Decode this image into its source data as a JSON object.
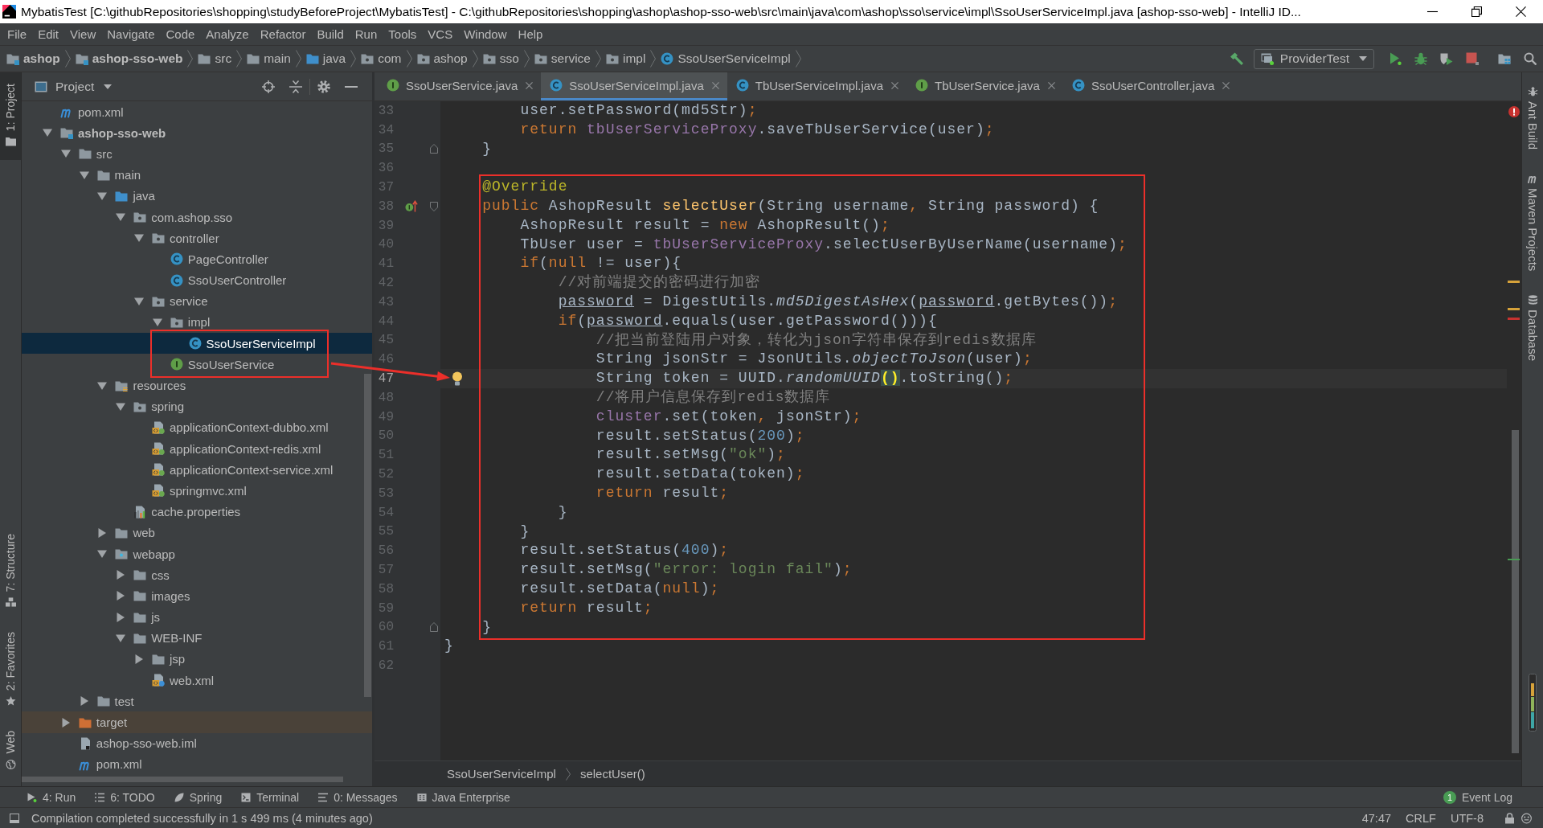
{
  "window": {
    "title": "MybatisTest [C:\\githubRepositories\\shopping\\studyBeforeProject\\MybatisTest] - C:\\githubRepositories\\shopping\\ashop\\ashop-sso-web\\src\\main\\java\\com\\ashop\\sso\\service\\impl\\SsoUserServiceImpl.java [ashop-sso-web] - IntelliJ ID..."
  },
  "menu": [
    "File",
    "Edit",
    "View",
    "Navigate",
    "Code",
    "Analyze",
    "Refactor",
    "Build",
    "Run",
    "Tools",
    "VCS",
    "Window",
    "Help"
  ],
  "navigation_bar": {
    "crumbs": [
      {
        "label": "ashop",
        "kind": "module"
      },
      {
        "label": "ashop-sso-web",
        "kind": "module"
      },
      {
        "label": "src",
        "kind": "folder"
      },
      {
        "label": "main",
        "kind": "folder"
      },
      {
        "label": "java",
        "kind": "source-root"
      },
      {
        "label": "com",
        "kind": "package"
      },
      {
        "label": "ashop",
        "kind": "package"
      },
      {
        "label": "sso",
        "kind": "package"
      },
      {
        "label": "service",
        "kind": "package"
      },
      {
        "label": "impl",
        "kind": "package"
      },
      {
        "label": "SsoUserServiceImpl",
        "kind": "class"
      }
    ],
    "run_configuration": "ProviderTest"
  },
  "left_strip": {
    "top": [
      {
        "label": "1: Project",
        "kind": "project",
        "selected": true
      }
    ],
    "bottom": [
      {
        "label": "7: Structure",
        "kind": "structure",
        "selected": false
      },
      {
        "label": "2: Favorites",
        "kind": "favorites",
        "selected": false
      },
      {
        "label": "Web",
        "kind": "web",
        "selected": false
      }
    ]
  },
  "right_strip": [
    {
      "label": "Ant Build",
      "kind": "ant"
    },
    {
      "label": "Maven Projects",
      "kind": "maven"
    },
    {
      "label": "Database",
      "kind": "database"
    }
  ],
  "project_panel": {
    "title": "Project",
    "tree": [
      {
        "label": "pom.xml",
        "kind": "maven",
        "selected": false
      },
      {
        "label": "ashop-sso-web",
        "kind": "module",
        "expanded": true,
        "selected": false,
        "children": [
          {
            "label": "src",
            "kind": "folder",
            "expanded": true,
            "selected": false,
            "children": [
              {
                "label": "main",
                "kind": "folder",
                "expanded": true,
                "selected": false,
                "children": [
                  {
                    "label": "java",
                    "kind": "source-root",
                    "expanded": true,
                    "selected": false,
                    "children": [
                      {
                        "label": "com.ashop.sso",
                        "kind": "package",
                        "expanded": true,
                        "selected": false,
                        "children": [
                          {
                            "label": "controller",
                            "kind": "package",
                            "expanded": true,
                            "selected": false,
                            "children": [
                              {
                                "label": "PageController",
                                "kind": "class",
                                "selected": false
                              },
                              {
                                "label": "SsoUserController",
                                "kind": "class",
                                "selected": false
                              }
                            ]
                          },
                          {
                            "label": "service",
                            "kind": "package",
                            "expanded": true,
                            "selected": false,
                            "children": [
                              {
                                "label": "impl",
                                "kind": "package",
                                "expanded": true,
                                "selected": false,
                                "children": [
                                  {
                                    "label": "SsoUserServiceImpl",
                                    "kind": "class",
                                    "selected": true
                                  }
                                ]
                              },
                              {
                                "label": "SsoUserService",
                                "kind": "interface",
                                "selected": false
                              }
                            ]
                          }
                        ]
                      }
                    ]
                  },
                  {
                    "label": "resources",
                    "kind": "resource-root",
                    "expanded": true,
                    "selected": false,
                    "children": [
                      {
                        "label": "spring",
                        "kind": "package",
                        "expanded": true,
                        "selected": false,
                        "children": [
                          {
                            "label": "applicationContext-dubbo.xml",
                            "kind": "spring-xml",
                            "selected": false
                          },
                          {
                            "label": "applicationContext-redis.xml",
                            "kind": "spring-xml",
                            "selected": false
                          },
                          {
                            "label": "applicationContext-service.xml",
                            "kind": "spring-xml",
                            "selected": false
                          },
                          {
                            "label": "springmvc.xml",
                            "kind": "spring-xml",
                            "selected": false
                          }
                        ]
                      },
                      {
                        "label": "cache.properties",
                        "kind": "properties",
                        "selected": false
                      }
                    ]
                  },
                  {
                    "label": "web",
                    "kind": "folder",
                    "expanded": false,
                    "selected": false
                  },
                  {
                    "label": "webapp",
                    "kind": "web-root",
                    "expanded": true,
                    "selected": false,
                    "children": [
                      {
                        "label": "css",
                        "kind": "folder",
                        "expanded": false,
                        "selected": false
                      },
                      {
                        "label": "images",
                        "kind": "folder",
                        "expanded": false,
                        "selected": false
                      },
                      {
                        "label": "js",
                        "kind": "folder",
                        "expanded": false,
                        "selected": false
                      },
                      {
                        "label": "WEB-INF",
                        "kind": "folder",
                        "expanded": true,
                        "selected": false,
                        "children": [
                          {
                            "label": "jsp",
                            "kind": "folder",
                            "expanded": false,
                            "selected": false
                          },
                          {
                            "label": "web.xml",
                            "kind": "web-xml",
                            "selected": false
                          }
                        ]
                      }
                    ]
                  }
                ]
              },
              {
                "label": "test",
                "kind": "folder",
                "expanded": false,
                "selected": false
              }
            ]
          },
          {
            "label": "target",
            "kind": "excluded",
            "expanded": false,
            "selected": false
          },
          {
            "label": "ashop-sso-web.iml",
            "kind": "iml",
            "selected": false
          },
          {
            "label": "pom.xml",
            "kind": "maven",
            "selected": false
          }
        ]
      }
    ]
  },
  "editor": {
    "tabs": [
      {
        "label": "SsoUserService.java",
        "kind": "interface",
        "selected": false
      },
      {
        "label": "SsoUserServiceImpl.java",
        "kind": "class",
        "selected": true
      },
      {
        "label": "TbUserServiceImpl.java",
        "kind": "class",
        "selected": false
      },
      {
        "label": "TbUserService.java",
        "kind": "interface",
        "selected": false
      },
      {
        "label": "SsoUserController.java",
        "kind": "class",
        "selected": false
      }
    ],
    "lines": [
      {
        "number": "33",
        "current": false,
        "tokens": [
          {
            "text": "        user.setPassword(md5Str)"
          },
          {
            "text": ";",
            "kind": "punct"
          }
        ]
      },
      {
        "number": "34",
        "current": false,
        "tokens": [
          {
            "text": "        return",
            "kind": "keyword"
          },
          {
            "text": " tbUserServiceProxy",
            "kind": "field"
          },
          {
            "text": ".saveTbUserService(user)"
          },
          {
            "text": ";",
            "kind": "punct"
          }
        ]
      },
      {
        "number": "35",
        "current": false,
        "gutter_icons": [
          {
            "kind": "fold-end"
          }
        ],
        "tokens": [
          {
            "text": "    }"
          }
        ]
      },
      {
        "number": "36",
        "current": false
      },
      {
        "number": "37",
        "current": false,
        "tokens": [
          {
            "text": "    @Override",
            "kind": "annotation"
          }
        ]
      },
      {
        "number": "38",
        "current": false,
        "gutter_icons": [
          {
            "kind": "implements"
          },
          {
            "kind": "fold-start"
          }
        ],
        "tokens": [
          {
            "text": "    public",
            "kind": "keyword"
          },
          {
            "text": " AshopResult "
          },
          {
            "text": "selectUser",
            "kind": "method"
          },
          {
            "text": "(String username"
          },
          {
            "text": ",",
            "kind": "punct"
          },
          {
            "text": " String password) {"
          }
        ]
      },
      {
        "number": "39",
        "current": false,
        "tokens": [
          {
            "text": "        AshopResult result = "
          },
          {
            "text": "new",
            "kind": "keyword"
          },
          {
            "text": " AshopResult()"
          },
          {
            "text": ";",
            "kind": "punct"
          }
        ]
      },
      {
        "number": "40",
        "current": false,
        "tokens": [
          {
            "text": "        TbUser user = "
          },
          {
            "text": "tbUserServiceProxy",
            "kind": "field"
          },
          {
            "text": ".selectUserByUserName(username)"
          },
          {
            "text": ";",
            "kind": "punct"
          }
        ]
      },
      {
        "number": "41",
        "current": false,
        "tokens": [
          {
            "text": "        if",
            "kind": "keyword"
          },
          {
            "text": "("
          },
          {
            "text": "null",
            "kind": "keyword"
          },
          {
            "text": " != user){"
          }
        ]
      },
      {
        "number": "42",
        "current": false,
        "tokens": [
          {
            "text": "            //对前端提交的密码进行加密",
            "kind": "comment"
          }
        ]
      },
      {
        "number": "43",
        "current": false,
        "tokens": [
          {
            "text": "            password",
            "kind": "reassigned"
          },
          {
            "text": " = DigestUtils."
          },
          {
            "text": "md5DigestAsHex",
            "kind": "static"
          },
          {
            "text": "("
          },
          {
            "text": "password",
            "kind": "reassigned"
          },
          {
            "text": ".getBytes())"
          },
          {
            "text": ";",
            "kind": "punct"
          }
        ]
      },
      {
        "number": "44",
        "current": false,
        "tokens": [
          {
            "text": "            if",
            "kind": "keyword"
          },
          {
            "text": "("
          },
          {
            "text": "password",
            "kind": "reassigned"
          },
          {
            "text": ".equals(user.getPassword())){"
          }
        ]
      },
      {
        "number": "45",
        "current": false,
        "tokens": [
          {
            "text": "                //把当前登陆用户对象，转化为json字符串保存到redis数据库",
            "kind": "comment"
          }
        ]
      },
      {
        "number": "46",
        "current": false,
        "tokens": [
          {
            "text": "                String jsonStr = JsonUtils."
          },
          {
            "text": "objectToJson",
            "kind": "static"
          },
          {
            "text": "(user)"
          },
          {
            "text": ";",
            "kind": "punct"
          }
        ]
      },
      {
        "number": "47",
        "current": true,
        "gutter_icons": [
          {
            "kind": "intention-bulb"
          }
        ],
        "tokens": [
          {
            "text": "                String token = UUID."
          },
          {
            "text": "randomUUID",
            "kind": "static"
          },
          {
            "text": "()",
            "kind": "brace-match"
          },
          {
            "text": ".toString()"
          },
          {
            "text": ";",
            "kind": "punct"
          }
        ]
      },
      {
        "number": "48",
        "current": false,
        "tokens": [
          {
            "text": "                //将用户信息保存到redis数据库",
            "kind": "comment"
          }
        ]
      },
      {
        "number": "49",
        "current": false,
        "tokens": [
          {
            "text": "                cluster",
            "kind": "field"
          },
          {
            "text": ".set(token"
          },
          {
            "text": ",",
            "kind": "punct"
          },
          {
            "text": " jsonStr)"
          },
          {
            "text": ";",
            "kind": "punct"
          }
        ]
      },
      {
        "number": "50",
        "current": false,
        "tokens": [
          {
            "text": "                result.setStatus("
          },
          {
            "text": "200",
            "kind": "number"
          },
          {
            "text": ")"
          },
          {
            "text": ";",
            "kind": "punct"
          }
        ]
      },
      {
        "number": "51",
        "current": false,
        "tokens": [
          {
            "text": "                result.setMsg("
          },
          {
            "text": "\"ok\"",
            "kind": "string"
          },
          {
            "text": ")"
          },
          {
            "text": ";",
            "kind": "punct"
          }
        ]
      },
      {
        "number": "52",
        "current": false,
        "tokens": [
          {
            "text": "                result.setData(token)"
          },
          {
            "text": ";",
            "kind": "punct"
          }
        ]
      },
      {
        "number": "53",
        "current": false,
        "tokens": [
          {
            "text": "                return",
            "kind": "keyword"
          },
          {
            "text": " result"
          },
          {
            "text": ";",
            "kind": "punct"
          }
        ]
      },
      {
        "number": "54",
        "current": false,
        "tokens": [
          {
            "text": "            }"
          }
        ]
      },
      {
        "number": "55",
        "current": false,
        "tokens": [
          {
            "text": "        }"
          }
        ]
      },
      {
        "number": "56",
        "current": false,
        "tokens": [
          {
            "text": "        result.setStatus("
          },
          {
            "text": "400",
            "kind": "number"
          },
          {
            "text": ")"
          },
          {
            "text": ";",
            "kind": "punct"
          }
        ]
      },
      {
        "number": "57",
        "current": false,
        "tokens": [
          {
            "text": "        result.setMsg("
          },
          {
            "text": "\"error: login fail\"",
            "kind": "string"
          },
          {
            "text": ")"
          },
          {
            "text": ";",
            "kind": "punct"
          }
        ]
      },
      {
        "number": "58",
        "current": false,
        "tokens": [
          {
            "text": "        result.setData("
          },
          {
            "text": "null",
            "kind": "keyword"
          },
          {
            "text": ")"
          },
          {
            "text": ";",
            "kind": "punct"
          }
        ]
      },
      {
        "number": "59",
        "current": false,
        "tokens": [
          {
            "text": "        return",
            "kind": "keyword"
          },
          {
            "text": " result"
          },
          {
            "text": ";",
            "kind": "punct"
          }
        ]
      },
      {
        "number": "60",
        "current": false,
        "gutter_icons": [
          {
            "kind": "fold-end"
          }
        ],
        "tokens": [
          {
            "text": "    }"
          }
        ]
      },
      {
        "number": "61",
        "current": false,
        "tokens": [
          {
            "text": "}"
          }
        ]
      },
      {
        "number": "62",
        "current": false
      }
    ],
    "breadcrumbs": [
      "SsoUserServiceImpl",
      "selectUser()"
    ]
  },
  "tool_window_bar": {
    "items": [
      {
        "label": "4: Run",
        "kind": "run"
      },
      {
        "label": "6: TODO",
        "kind": "todo"
      },
      {
        "label": "Spring",
        "kind": "spring"
      },
      {
        "label": "Terminal",
        "kind": "terminal"
      },
      {
        "label": "0: Messages",
        "kind": "messages"
      },
      {
        "label": "Java Enterprise",
        "kind": "java-ee"
      }
    ],
    "event_log": {
      "label": "Event Log",
      "count": "1"
    }
  },
  "status_bar": {
    "message": "Compilation completed successfully in 1 s 499 ms (4 minutes ago)",
    "position": "47:47",
    "line_separator": "CRLF",
    "encoding": "UTF-8"
  }
}
